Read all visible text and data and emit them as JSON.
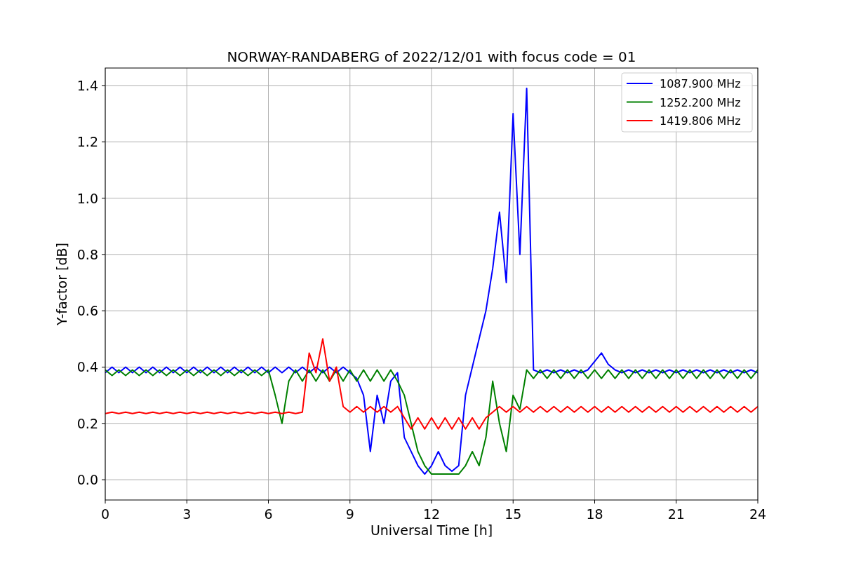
{
  "figure": {
    "chart_data": {
      "type": "line",
      "title": "NORWAY-RANDABERG of 2022/12/01 with focus code = 01",
      "xlabel": "Universal Time [h]",
      "ylabel": "Y-factor [dB]",
      "x": [
        0,
        0.25,
        0.5,
        0.75,
        1,
        1.25,
        1.5,
        1.75,
        2,
        2.25,
        2.5,
        2.75,
        3,
        3.25,
        3.5,
        3.75,
        4,
        4.25,
        4.5,
        4.75,
        5,
        5.25,
        5.5,
        5.75,
        6,
        6.25,
        6.5,
        6.75,
        7,
        7.25,
        7.5,
        7.75,
        8,
        8.25,
        8.5,
        8.75,
        9,
        9.25,
        9.5,
        9.75,
        10,
        10.25,
        10.5,
        10.75,
        11,
        11.25,
        11.5,
        11.75,
        12,
        12.25,
        12.5,
        12.75,
        13,
        13.25,
        13.5,
        13.75,
        14,
        14.25,
        14.5,
        14.75,
        15,
        15.25,
        15.5,
        15.75,
        16,
        16.25,
        16.5,
        16.75,
        17,
        17.25,
        17.5,
        17.75,
        18,
        18.25,
        18.5,
        18.75,
        19,
        19.25,
        19.5,
        19.75,
        20,
        20.25,
        20.5,
        20.75,
        21,
        21.25,
        21.5,
        21.75,
        22,
        22.25,
        22.5,
        22.75,
        23,
        23.25,
        23.5,
        23.75,
        24
      ],
      "series": [
        {
          "name": "1087.900 MHz",
          "color": "#0000ff",
          "values": [
            0.38,
            0.4,
            0.38,
            0.4,
            0.38,
            0.4,
            0.38,
            0.4,
            0.38,
            0.4,
            0.38,
            0.4,
            0.38,
            0.4,
            0.38,
            0.4,
            0.38,
            0.4,
            0.38,
            0.4,
            0.38,
            0.4,
            0.38,
            0.4,
            0.38,
            0.4,
            0.38,
            0.4,
            0.38,
            0.4,
            0.38,
            0.4,
            0.38,
            0.4,
            0.38,
            0.4,
            0.38,
            0.36,
            0.3,
            0.1,
            0.3,
            0.2,
            0.35,
            0.38,
            0.15,
            0.1,
            0.05,
            0.02,
            0.05,
            0.1,
            0.05,
            0.03,
            0.05,
            0.3,
            0.4,
            0.5,
            0.6,
            0.75,
            0.95,
            0.7,
            1.3,
            0.8,
            1.39,
            0.39,
            0.38,
            0.39,
            0.38,
            0.39,
            0.38,
            0.39,
            0.38,
            0.39,
            0.42,
            0.45,
            0.41,
            0.39,
            0.38,
            0.39,
            0.38,
            0.39,
            0.38,
            0.39,
            0.38,
            0.39,
            0.38,
            0.39,
            0.38,
            0.39,
            0.38,
            0.39,
            0.38,
            0.39,
            0.38,
            0.39,
            0.38,
            0.39,
            0.38
          ]
        },
        {
          "name": "1252.200 MHz",
          "color": "#008000",
          "values": [
            0.39,
            0.37,
            0.39,
            0.37,
            0.39,
            0.37,
            0.39,
            0.37,
            0.39,
            0.37,
            0.39,
            0.37,
            0.39,
            0.37,
            0.39,
            0.37,
            0.39,
            0.37,
            0.39,
            0.37,
            0.39,
            0.37,
            0.39,
            0.37,
            0.39,
            0.3,
            0.2,
            0.35,
            0.39,
            0.35,
            0.39,
            0.35,
            0.39,
            0.35,
            0.39,
            0.35,
            0.39,
            0.35,
            0.39,
            0.35,
            0.39,
            0.35,
            0.39,
            0.35,
            0.3,
            0.2,
            0.1,
            0.05,
            0.02,
            0.02,
            0.02,
            0.02,
            0.02,
            0.05,
            0.1,
            0.05,
            0.15,
            0.35,
            0.2,
            0.1,
            0.3,
            0.25,
            0.39,
            0.36,
            0.39,
            0.36,
            0.39,
            0.36,
            0.39,
            0.36,
            0.39,
            0.36,
            0.39,
            0.36,
            0.39,
            0.36,
            0.39,
            0.36,
            0.39,
            0.36,
            0.39,
            0.36,
            0.39,
            0.36,
            0.39,
            0.36,
            0.39,
            0.36,
            0.39,
            0.36,
            0.39,
            0.36,
            0.39,
            0.36,
            0.39,
            0.36,
            0.39
          ]
        },
        {
          "name": "1419.806 MHz",
          "color": "#ff0000",
          "values": [
            0.235,
            0.24,
            0.235,
            0.24,
            0.235,
            0.24,
            0.235,
            0.24,
            0.235,
            0.24,
            0.235,
            0.24,
            0.235,
            0.24,
            0.235,
            0.24,
            0.235,
            0.24,
            0.235,
            0.24,
            0.235,
            0.24,
            0.235,
            0.24,
            0.235,
            0.24,
            0.235,
            0.24,
            0.235,
            0.24,
            0.45,
            0.38,
            0.5,
            0.35,
            0.4,
            0.26,
            0.24,
            0.26,
            0.24,
            0.26,
            0.24,
            0.26,
            0.24,
            0.26,
            0.22,
            0.18,
            0.22,
            0.18,
            0.22,
            0.18,
            0.22,
            0.18,
            0.22,
            0.18,
            0.22,
            0.18,
            0.22,
            0.24,
            0.26,
            0.24,
            0.26,
            0.24,
            0.26,
            0.24,
            0.26,
            0.24,
            0.26,
            0.24,
            0.26,
            0.24,
            0.26,
            0.24,
            0.26,
            0.24,
            0.26,
            0.24,
            0.26,
            0.24,
            0.26,
            0.24,
            0.26,
            0.24,
            0.26,
            0.24,
            0.26,
            0.24,
            0.26,
            0.24,
            0.26,
            0.24,
            0.26,
            0.24,
            0.26,
            0.24,
            0.26,
            0.24,
            0.26
          ]
        }
      ],
      "grid": true,
      "legend": true,
      "xlim": [
        0,
        24
      ],
      "ylim": [
        -0.072,
        1.462
      ],
      "xticks": [
        0,
        3,
        6,
        9,
        12,
        15,
        18,
        21,
        24
      ],
      "yticks": [
        {
          "value": 0,
          "label": "0.0"
        },
        {
          "value": 0.2,
          "label": "0.2"
        },
        {
          "value": 0.4,
          "label": "0.4"
        },
        {
          "value": 0.6,
          "label": "0.6"
        },
        {
          "value": 0.8,
          "label": "0.8"
        },
        {
          "value": 1,
          "label": "1.0"
        },
        {
          "value": 1.2,
          "label": "1.2"
        },
        {
          "value": 1.4,
          "label": "1.4"
        }
      ]
    }
  }
}
